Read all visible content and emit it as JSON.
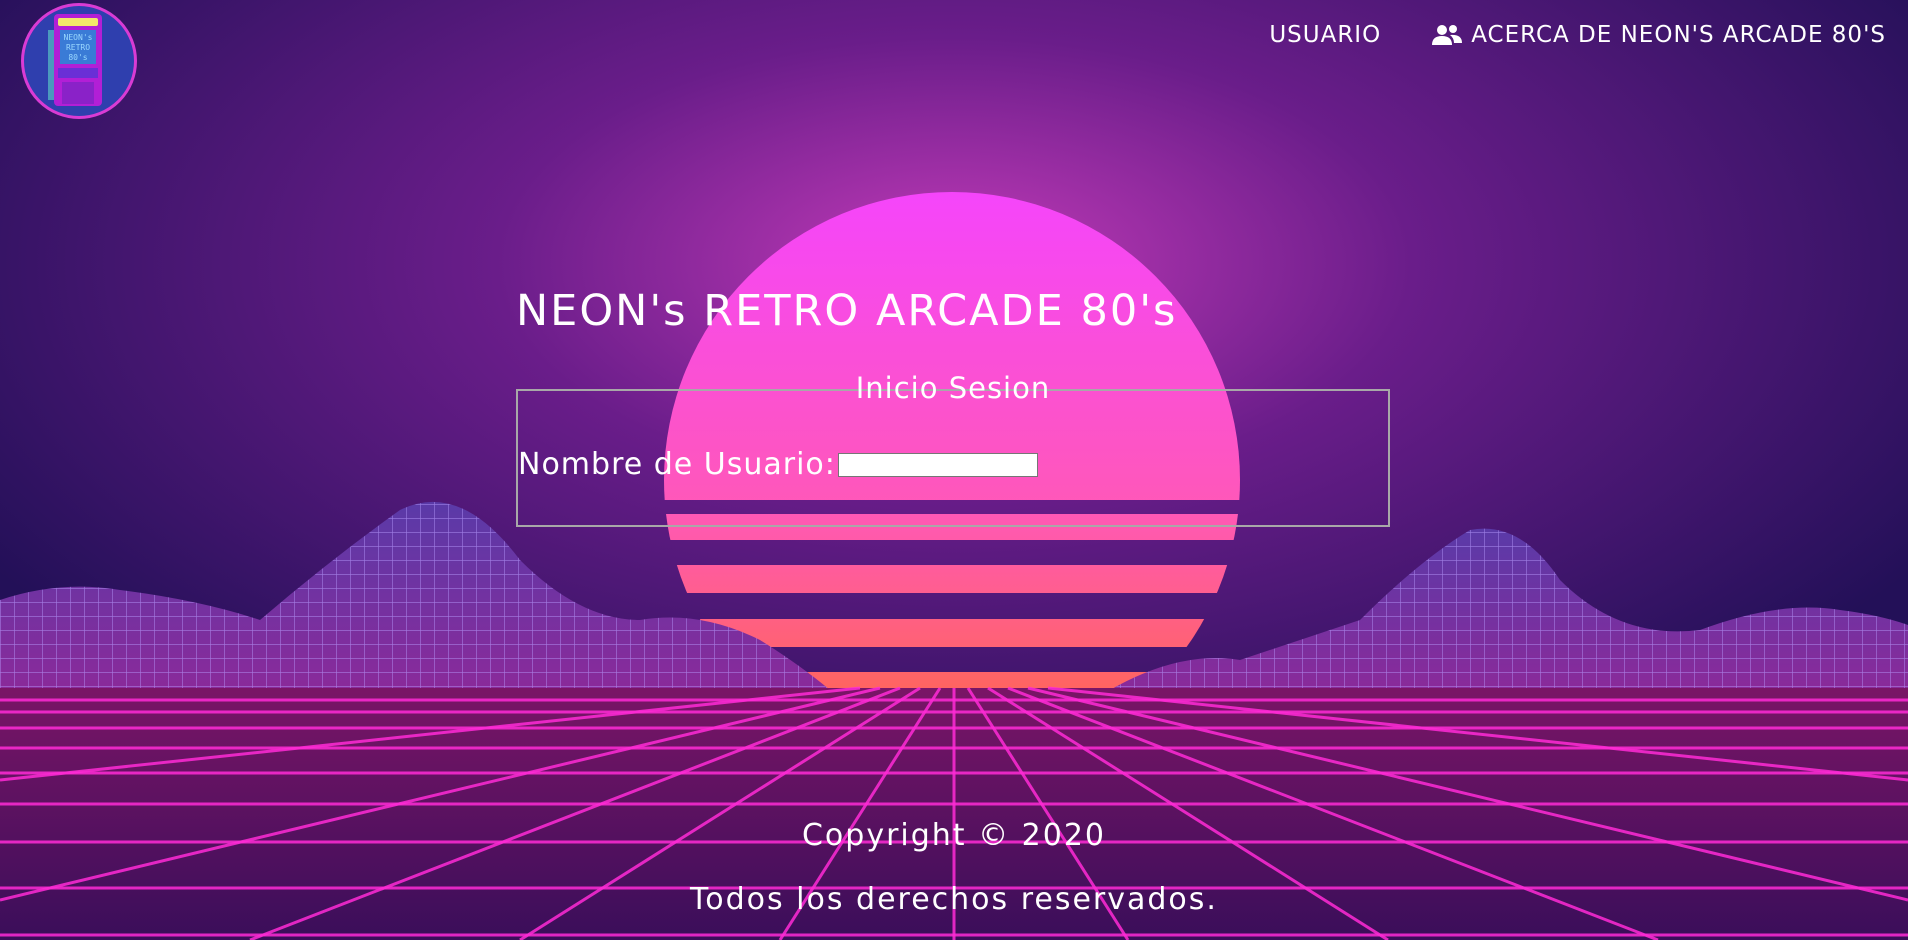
{
  "nav": {
    "user_label": "USUARIO",
    "about_label": "ACERCA DE NEON'S ARCADE 80'S",
    "about_icon": "users-icon"
  },
  "logo": {
    "text": "NEON's RETRO 80's",
    "icon": "arcade-cabinet-logo"
  },
  "main": {
    "title": "NEON's RETRO ARCADE 80's"
  },
  "login": {
    "legend": "Inicio Sesion",
    "username_label": "Nombre de Usuario:",
    "username_value": ""
  },
  "footer": {
    "copyright": "Copyright © 2020",
    "rights": "Todos los derechos reservados."
  },
  "colors": {
    "sky_top": "#2a0f5e",
    "sun_top": "#f646f8",
    "sun_bottom": "#ff6a3d",
    "grid": "#ff2bd6",
    "mountain": "#7b5ad6"
  }
}
